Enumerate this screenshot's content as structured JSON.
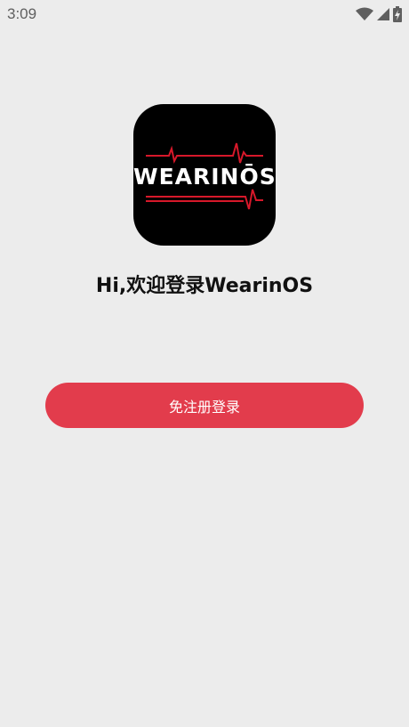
{
  "status_bar": {
    "time": "3:09",
    "icons": [
      "wifi-icon",
      "signal-icon",
      "battery-charging-icon"
    ]
  },
  "logo": {
    "text": "WEARINŌS",
    "accent_color": "#d7182a"
  },
  "title": "Hi,欢迎登录WearinOS",
  "login_button": {
    "label": "免注册登录",
    "color": "#e23c4c"
  },
  "colors": {
    "background": "#ececec",
    "logo_background": "#000000"
  }
}
